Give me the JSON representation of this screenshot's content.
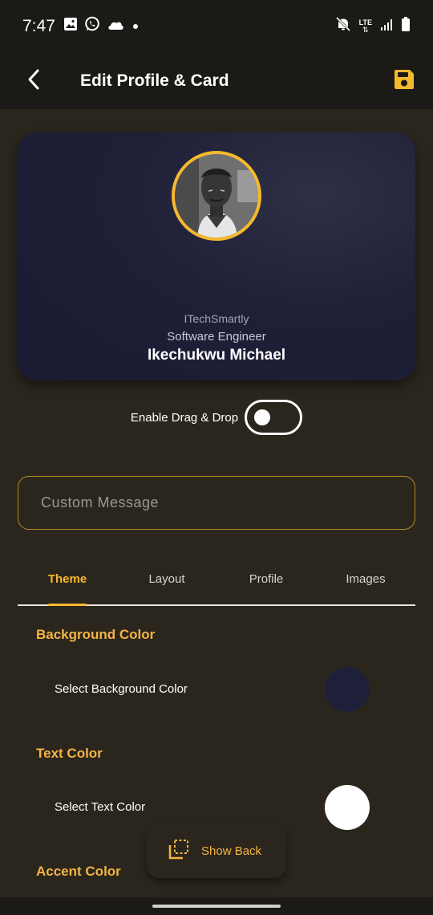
{
  "status_bar": {
    "time": "7:47",
    "icons_left": [
      "image-icon",
      "whatsapp-icon",
      "cloud-icon",
      "dot-icon"
    ],
    "icons_right": [
      "mute-icon",
      "lte-icon",
      "signal-icon",
      "battery-icon"
    ],
    "lte_label": "LTE"
  },
  "app_bar": {
    "title": "Edit Profile & Card",
    "back_icon": "back-arrow-icon",
    "save_icon": "save-icon"
  },
  "card": {
    "company": "ITechSmartly",
    "role": "Software Engineer",
    "name": "Ikechukwu Michael",
    "background_color": "#1f2038",
    "avatar_border_color": "#f5b92d"
  },
  "drag_drop": {
    "label": "Enable Drag & Drop",
    "enabled": false
  },
  "custom_message": {
    "placeholder": "Custom Message",
    "value": ""
  },
  "tabs": [
    {
      "label": "Theme",
      "active": true
    },
    {
      "label": "Layout",
      "active": false
    },
    {
      "label": "Profile",
      "active": false
    },
    {
      "label": "Images",
      "active": false
    }
  ],
  "theme": {
    "background_color": {
      "title": "Background Color",
      "label": "Select Background Color",
      "value": "#1e1f38"
    },
    "text_color": {
      "title": "Text Color",
      "label": "Select Text Color",
      "value": "#ffffff"
    },
    "accent_color": {
      "title": "Accent Color"
    }
  },
  "fab": {
    "label": "Show Back",
    "icon": "flip-icon"
  },
  "colors": {
    "accent": "#f5b92d",
    "page_background": "#2b261d",
    "app_bar_background": "#1b1a16"
  }
}
